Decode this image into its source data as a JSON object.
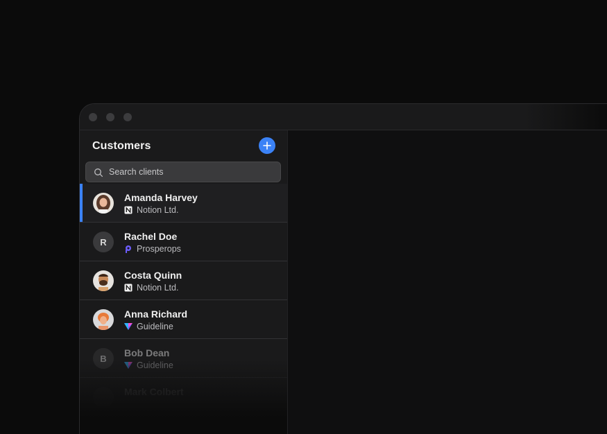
{
  "sidebar": {
    "title": "Customers",
    "add_button_icon": "plus-icon",
    "search_placeholder": "Search clients",
    "customers": [
      {
        "name": "Amanda Harvey",
        "company": "Notion Ltd.",
        "company_icon": "notion-logo-icon",
        "avatar": "photo",
        "selected": true
      },
      {
        "name": "Rachel Doe",
        "company": "Prosperops",
        "company_icon": "prosperops-logo-icon",
        "initial": "R"
      },
      {
        "name": "Costa Quinn",
        "company": "Notion Ltd.",
        "company_icon": "notion-logo-icon",
        "avatar": "photo"
      },
      {
        "name": "Anna Richard",
        "company": "Guideline",
        "company_icon": "guideline-logo-icon",
        "avatar": "photo"
      },
      {
        "name": "Bob Dean",
        "company": "Guideline",
        "company_icon": "guideline-logo-icon",
        "initial": "B"
      },
      {
        "name": "Mark Colbert",
        "company": "",
        "initial": ""
      }
    ]
  },
  "colors": {
    "accent": "#3b82f6",
    "background": "#0b0b0b",
    "sidebar": "#1a1a1b"
  }
}
